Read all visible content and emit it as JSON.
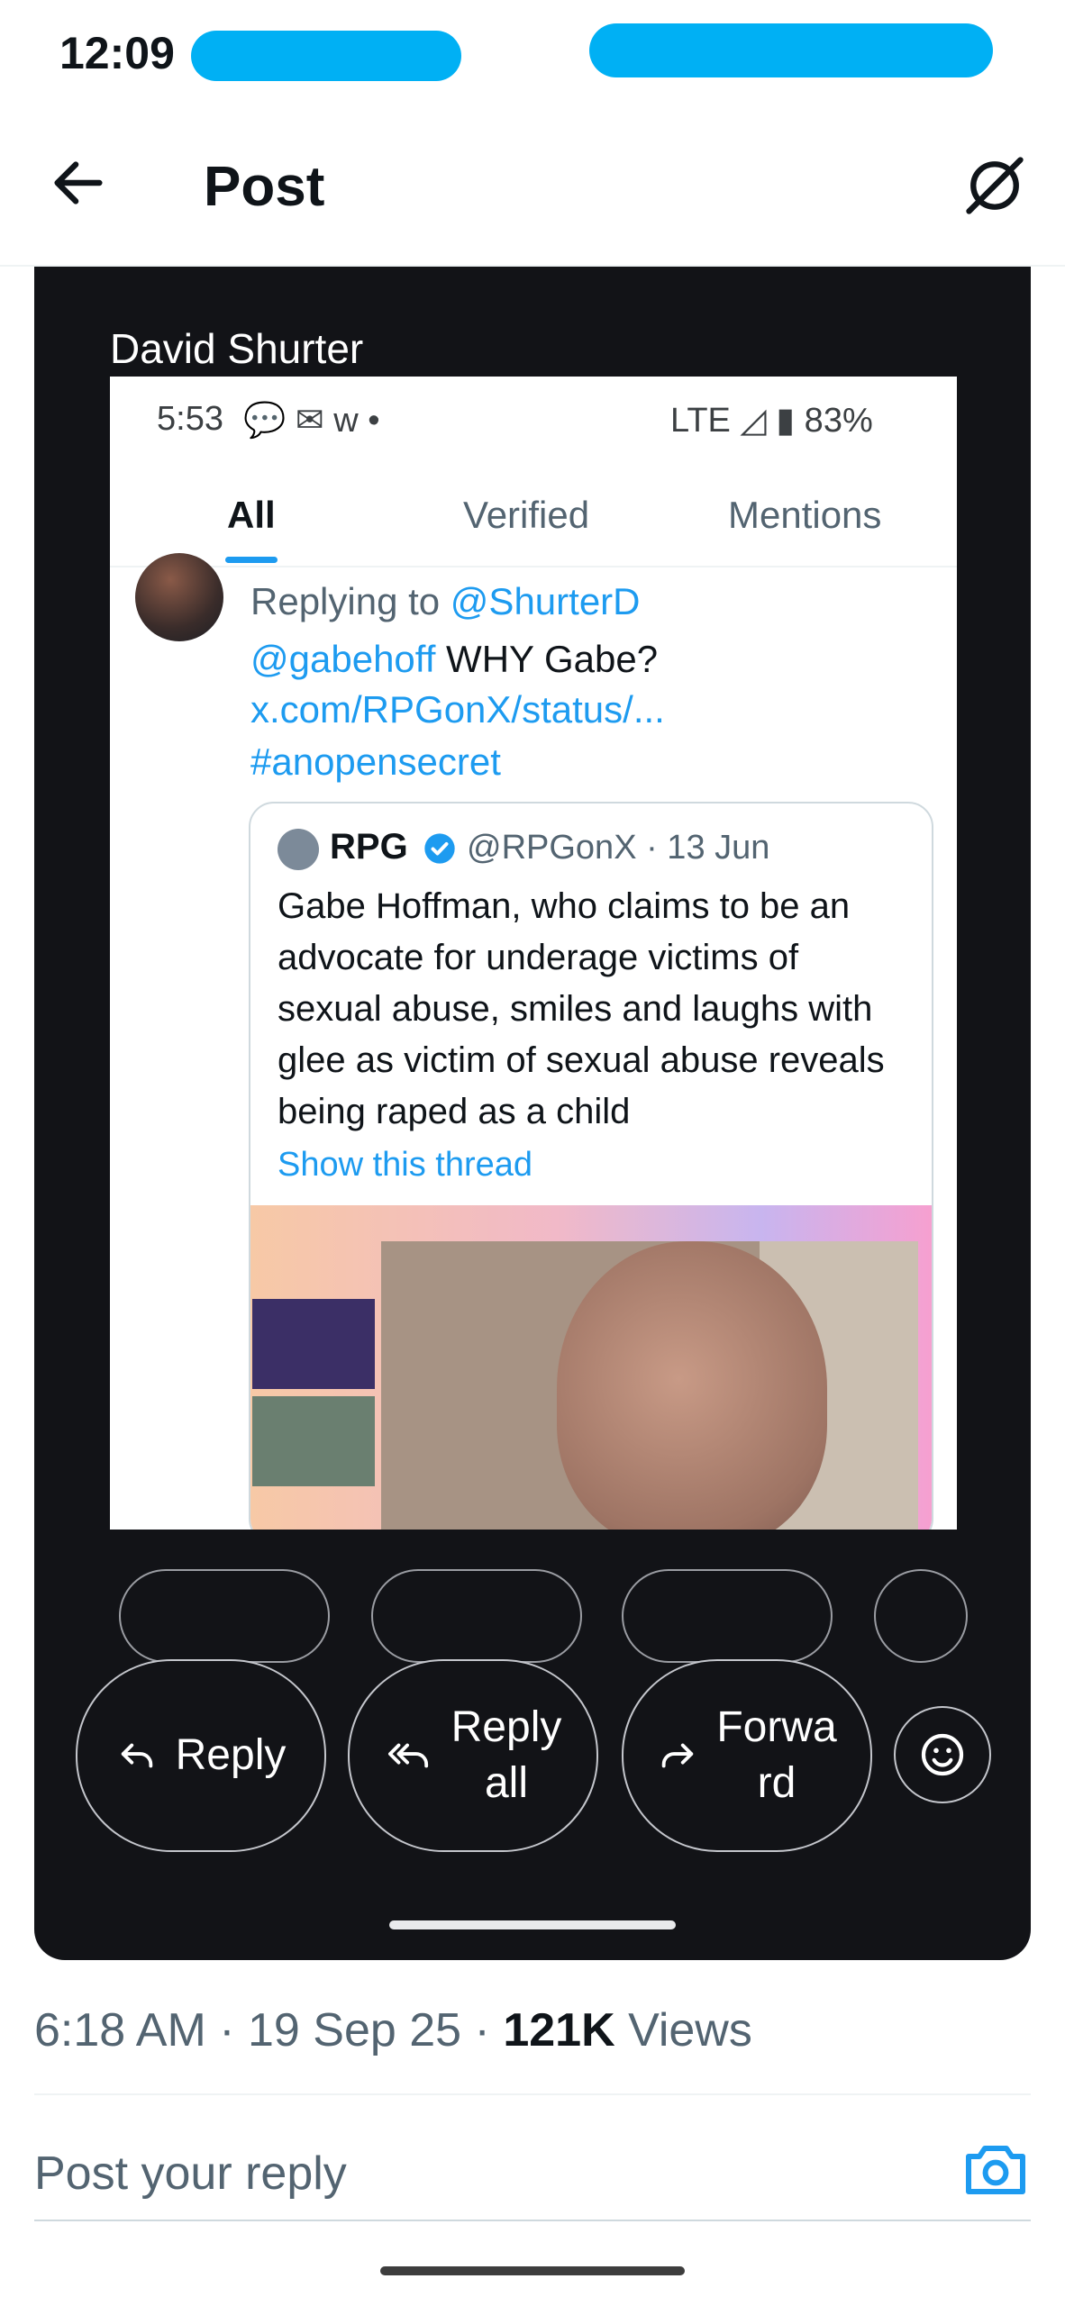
{
  "status_bar": {
    "time": "12:09"
  },
  "header": {
    "title": "Post"
  },
  "card": {
    "author": "David Shurter",
    "inner_status": {
      "time": "5:53",
      "icons": "💬 ✉ w •",
      "right": "LTE ◿ ▮ 83%"
    },
    "tabs": [
      "All",
      "Verified",
      "Mentions"
    ],
    "reply": {
      "replying_to_label": "Replying to",
      "replying_to_handle": "@ShurterD",
      "mention": "@gabehoff",
      "text": "WHY Gabe?",
      "link": "x.com/RPGonX/status/...",
      "hashtag": "#anopensecret"
    },
    "quote": {
      "name": "RPG",
      "handle_date": "@RPGonX · 13 Jun",
      "text": "Gabe Hoffman, who claims to be an advocate for underage victims of sexual abuse, smiles and laughs with glee as victim of sexual abuse reveals being raped as a child",
      "show_thread": "Show this thread"
    },
    "actions": {
      "reply": "Reply",
      "reply_all_1": "Reply",
      "reply_all_2": "all",
      "forward_1": "Forwa",
      "forward_2": "rd"
    }
  },
  "meta": {
    "time": "6:18 AM · 19 Sep 25 · ",
    "views_count": "121K",
    "views_label": " Views"
  },
  "reply_bar": {
    "placeholder": "Post your reply"
  },
  "colors": {
    "accent": "#1d9bf0",
    "card_bg": "#121317",
    "redaction": "#00b0f4"
  }
}
